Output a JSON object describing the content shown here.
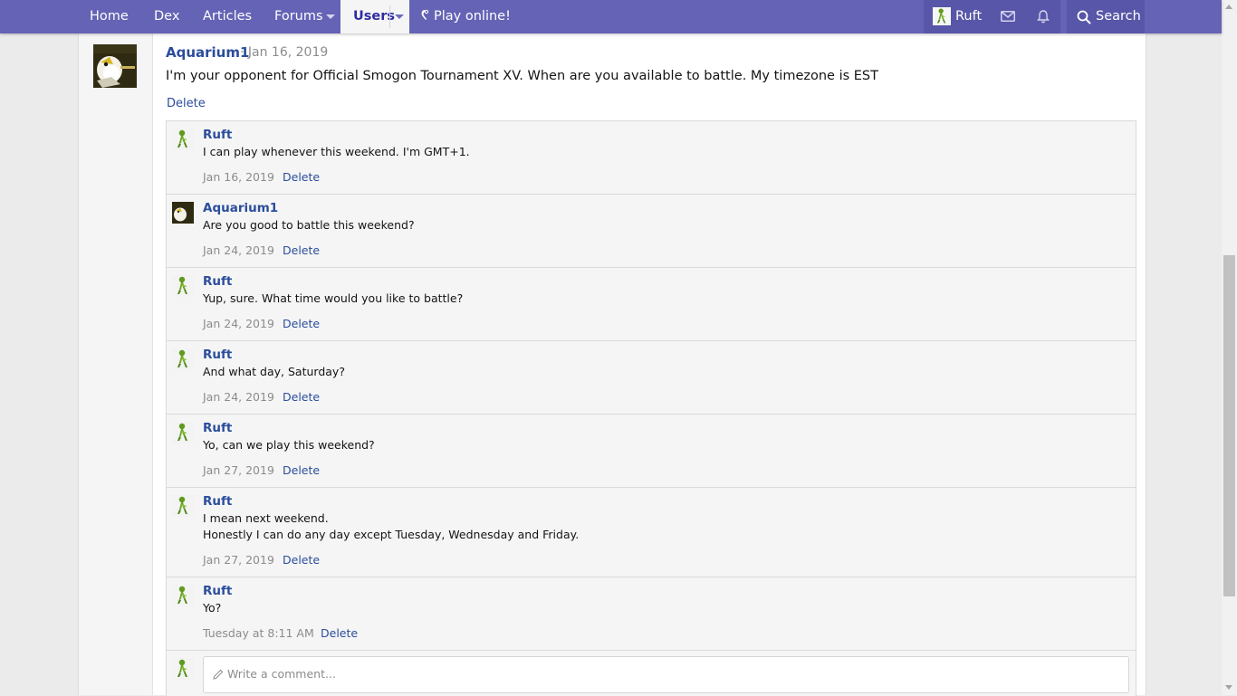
{
  "nav": {
    "home": "Home",
    "dex": "Dex",
    "articles": "Articles",
    "forums": "Forums",
    "users": "Users",
    "play": "Play online!",
    "user": "Ruft",
    "search": "Search"
  },
  "colors": {
    "nav_bg": "#6563b5",
    "link": "#2b4d9c",
    "muted": "#8c8c8c"
  },
  "post": {
    "author": "Aquarium1",
    "date": "· Jan 16, 2019",
    "text": "I'm your opponent for Official Smogon Tournament XV. When are you available to battle. My timezone is EST",
    "delete": "Delete"
  },
  "comments": [
    {
      "author": "Ruft",
      "lines": [
        "I can play whenever this weekend. I'm GMT+1."
      ],
      "date": "Jan 16, 2019",
      "delete": "Delete"
    },
    {
      "author": "Aquarium1",
      "lines": [
        "Are you good to battle this weekend?"
      ],
      "date": "Jan 24, 2019",
      "delete": "Delete"
    },
    {
      "author": "Ruft",
      "lines": [
        "Yup, sure. What time would you like to battle?"
      ],
      "date": "Jan 24, 2019",
      "delete": "Delete"
    },
    {
      "author": "Ruft",
      "lines": [
        "And what day, Saturday?"
      ],
      "date": "Jan 24, 2019",
      "delete": "Delete"
    },
    {
      "author": "Ruft",
      "lines": [
        "Yo, can we play this weekend?"
      ],
      "date": "Jan 27, 2019",
      "delete": "Delete"
    },
    {
      "author": "Ruft",
      "lines": [
        "I mean next weekend.",
        "Honestly I can do any day except Tuesday, Wednesday and Friday."
      ],
      "date": "Jan 27, 2019",
      "delete": "Delete"
    },
    {
      "author": "Ruft",
      "lines": [
        "Yo?"
      ],
      "date": "Tuesday at 8:11 AM",
      "delete": "Delete"
    }
  ],
  "reply": {
    "placeholder": "Write a comment..."
  }
}
